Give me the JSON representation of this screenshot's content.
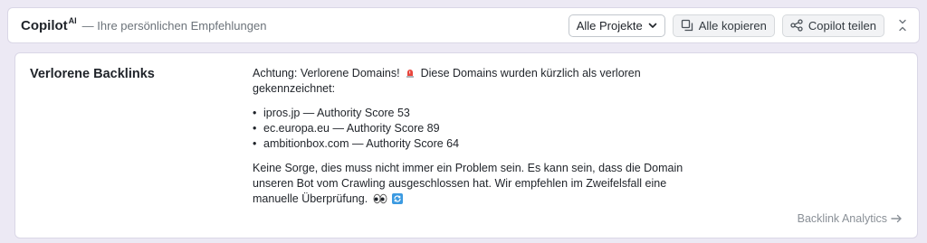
{
  "header": {
    "brand": "Copilot",
    "brand_sup": "AI",
    "subtitle": "— Ihre persönlichen Empfehlungen",
    "project_select": "Alle Projekte",
    "copy_all_label": "Alle kopieren",
    "share_label": "Copilot teilen"
  },
  "card": {
    "title": "Verlorene Backlinks",
    "intro_before": "Achtung: Verlorene Domains!",
    "intro_after": "Diese Domains wurden kürzlich als verloren gekennzeichnet:",
    "domains": [
      "ipros.jp — Authority Score 53",
      "ec.europa.eu — Authority Score 89",
      "ambitionbox.com — Authority Score 64"
    ],
    "note": "Keine Sorge, dies muss nicht immer ein Problem sein. Es kann sein, dass die Domain unseren Bot vom Crawling ausgeschlossen hat. Wir empfehlen im Zweifelsfall eine manuelle Überprüfung.",
    "link_label": "Backlink Analytics"
  },
  "colors": {
    "page_bg": "#ece9f4",
    "alert_red": "#e8453c",
    "refresh_blue": "#3b9ae1",
    "muted_text": "#8a9097"
  }
}
